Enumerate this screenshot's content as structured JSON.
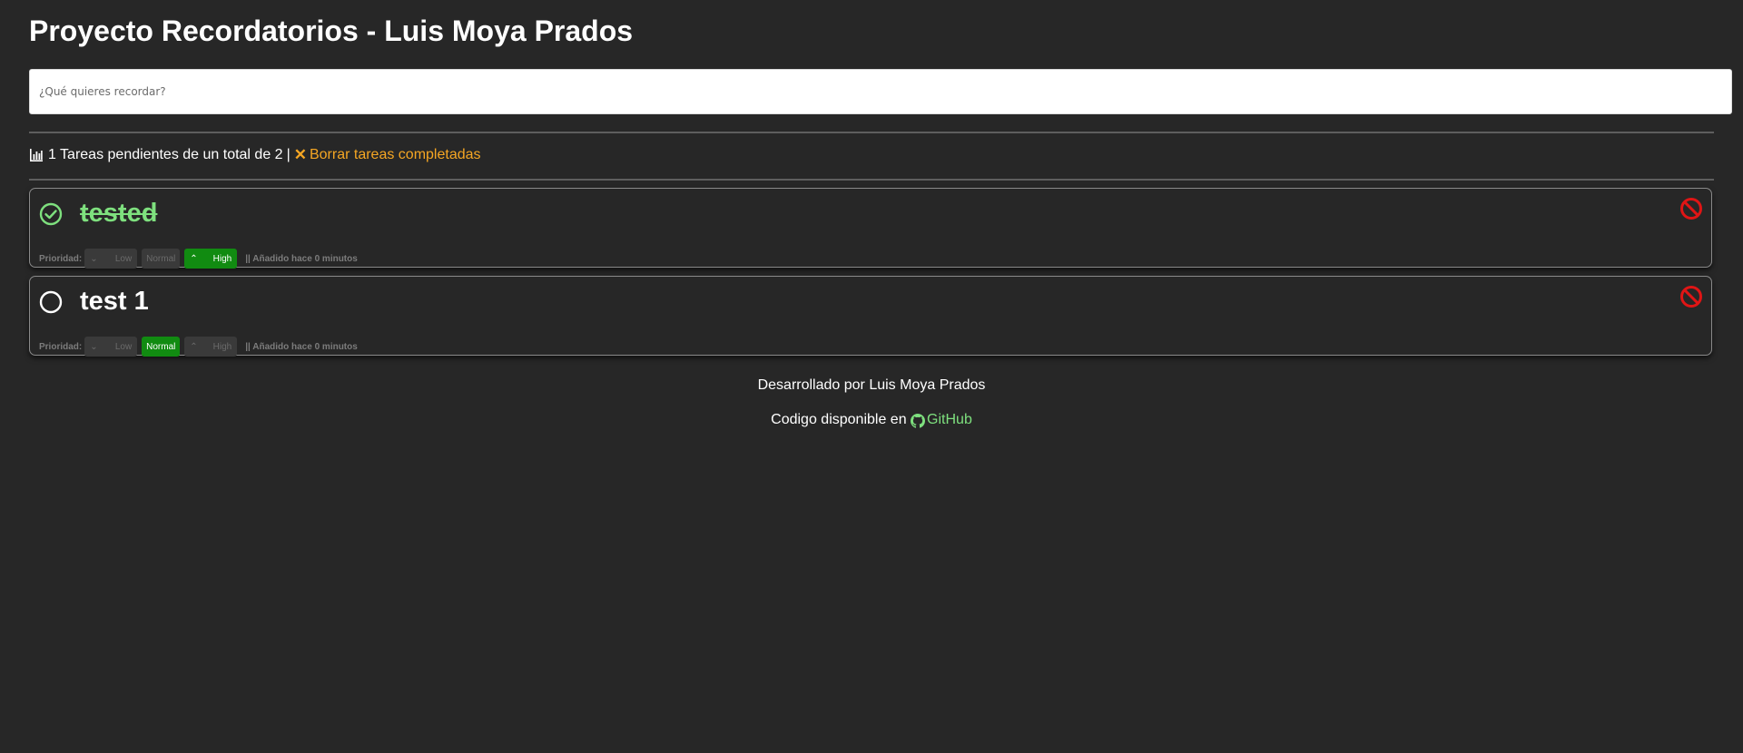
{
  "app": {
    "title": "Proyecto Recordatorios - Luis Moya Prados"
  },
  "input": {
    "placeholder": "¿Qué quieres recordar?",
    "value": ""
  },
  "stats": {
    "icon": "bar-chart-icon",
    "pending_text": "1 Tareas pendientes de un total de 2",
    "separator": "|",
    "clear_icon": "x-icon",
    "clear_label": "Borrar tareas completadas",
    "clear_color": "#f5a623"
  },
  "tasks": [
    {
      "title": "tested",
      "completed": true,
      "priority_label": "Prioridad:",
      "priority_selected": "High",
      "priority_options": [
        "Low",
        "Normal",
        "High"
      ],
      "added": "|| Añadido hace 0 minutos"
    },
    {
      "title": "test 1",
      "completed": false,
      "priority_label": "Prioridad:",
      "priority_selected": "Normal",
      "priority_options": [
        "Low",
        "Normal",
        "High"
      ],
      "added": "|| Añadido hace 0 minutos"
    }
  ],
  "footer": {
    "developed_by": "Desarrollado por Luis Moya Prados",
    "code_text": "Codigo disponible en",
    "github_label": "GitHub"
  },
  "colors": {
    "background": "#272727",
    "completed_green": "#7ee07e",
    "priority_active": "#118b11",
    "delete_red": "#e01515",
    "link_orange": "#f5a623"
  }
}
